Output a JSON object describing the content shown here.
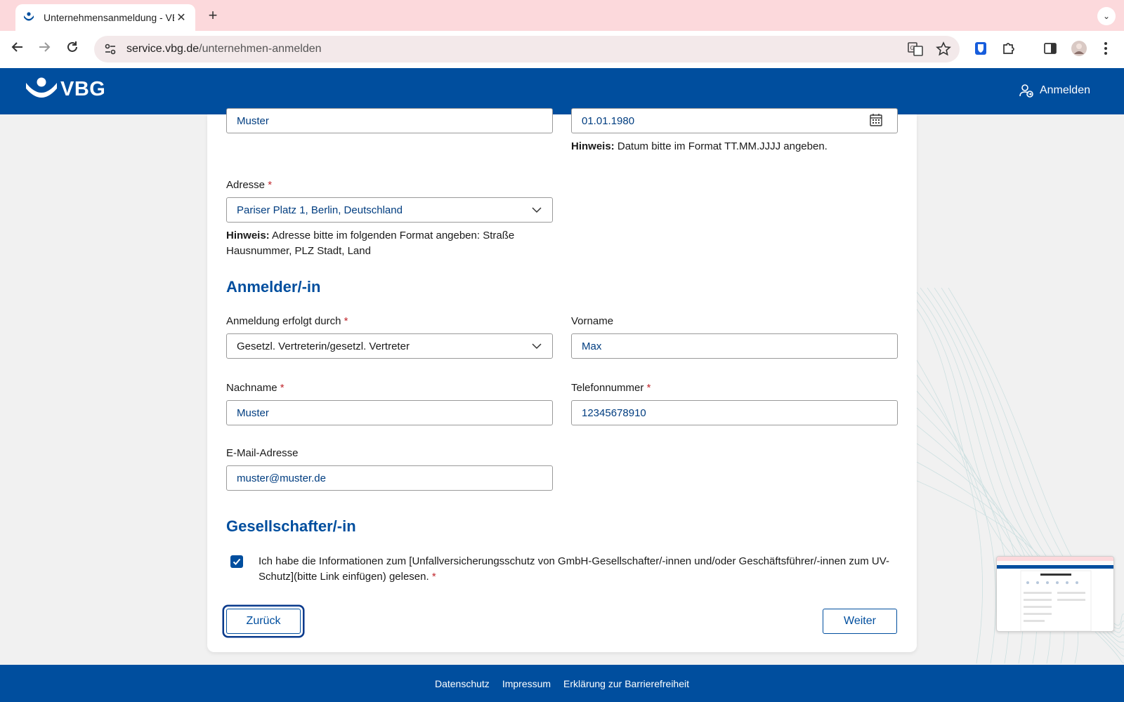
{
  "browser": {
    "tab_title": "Unternehmensanmeldung - VBG",
    "url_host": "service.vbg.de",
    "url_path": "/unternehmen-anmelden"
  },
  "header": {
    "logo_text": "VBG",
    "login_label": "Anmelden"
  },
  "form": {
    "top_left_value": "Muster",
    "top_right_value": "01.01.1980",
    "date_hint_bold": "Hinweis:",
    "date_hint_text": " Datum bitte im Format TT.MM.JJJJ angeben.",
    "address": {
      "label": "Adresse",
      "value": "Pariser Platz 1, Berlin, Deutschland",
      "hint_bold": "Hinweis:",
      "hint_text": " Adresse bitte im folgenden Format angeben: Straße Hausnummer, PLZ Stadt, Land"
    },
    "section_registrant": "Anmelder/-in",
    "registration_by": {
      "label": "Anmeldung erfolgt durch",
      "value": "Gesetzl. Vertreterin/gesetzl. Vertreter"
    },
    "first_name": {
      "label": "Vorname",
      "value": "Max"
    },
    "last_name": {
      "label": "Nachname",
      "value": "Muster"
    },
    "phone": {
      "label": "Telefonnummer",
      "value": "12345678910"
    },
    "email": {
      "label": "E-Mail-Adresse",
      "value": "muster@muster.de"
    },
    "section_shareholder": "Gesellschafter/-in",
    "consent_text": "Ich habe die Informationen zum [Unfallversicherungsschutz von GmbH-Gesellschafter/-innen und/oder Geschäftsführer/-innen zum UV-Schutz](bitte Link einfügen) gelesen.",
    "required_mark": "*",
    "back_label": "Zurück",
    "next_label": "Weiter"
  },
  "footer": {
    "links": [
      "Datenschutz",
      "Impressum",
      "Erklärung zur Barrierefreiheit"
    ]
  },
  "colors": {
    "brand": "#004e9e",
    "required": "#c0272d",
    "tabbar": "#fcd9dc"
  }
}
